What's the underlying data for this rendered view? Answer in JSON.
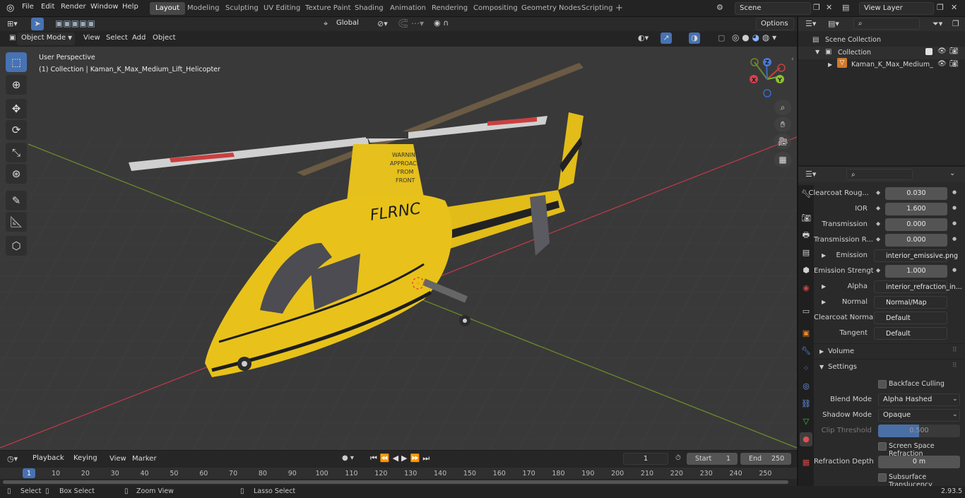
{
  "menu": [
    "File",
    "Edit",
    "Render",
    "Window",
    "Help"
  ],
  "workspaces": [
    "Layout",
    "Modeling",
    "Sculpting",
    "UV Editing",
    "Texture Paint",
    "Shading",
    "Animation",
    "Rendering",
    "Compositing",
    "Geometry Nodes",
    "Scripting"
  ],
  "scene": {
    "name": "Scene",
    "view_layer": "View Layer"
  },
  "header": {
    "mode": "Object Mode",
    "menus": [
      "View",
      "Select",
      "Add",
      "Object"
    ],
    "transform": "Global",
    "options": "Options"
  },
  "viewport": {
    "perspective": "User Perspective",
    "collection_info": "(1) Collection | Kaman_K_Max_Medium_Lift_Helicopter",
    "decal_text": "FLRNC",
    "warning_text": [
      "WARNING",
      "APPROACH",
      "FROM",
      "FRONT"
    ]
  },
  "gizmo": {
    "x": "X",
    "y": "Y",
    "z": "Z"
  },
  "outliner": {
    "root": "Scene Collection",
    "collection": "Collection",
    "object": "Kaman_K_Max_Medium_"
  },
  "properties": {
    "rows": [
      {
        "label": "Clearcoat Roug...",
        "value": "0.030"
      },
      {
        "label": "IOR",
        "value": "1.600"
      },
      {
        "label": "Transmission",
        "value": "0.000"
      },
      {
        "label": "Transmission R...",
        "value": "0.000"
      },
      {
        "label": "Emission",
        "value": "interior_emissive.png"
      },
      {
        "label": "Emission Strengt",
        "value": "1.000"
      },
      {
        "label": "Alpha",
        "value": "interior_refraction_in..."
      },
      {
        "label": "Normal",
        "value": "Normal/Map"
      },
      {
        "label": "Clearcoat Normal",
        "value": "Default"
      },
      {
        "label": "Tangent",
        "value": "Default"
      }
    ],
    "volume": "Volume",
    "settings": "Settings",
    "backface": "Backface Culling",
    "blend_mode_label": "Blend Mode",
    "blend_mode": "Alpha Hashed",
    "shadow_mode_label": "Shadow Mode",
    "shadow_mode": "Opaque",
    "clip_label": "Clip Threshold",
    "clip_value": "0.500",
    "ssr": "Screen Space Refraction",
    "refraction_label": "Refraction Depth",
    "refraction_value": "0 m",
    "sss": "Subsurface Translucency"
  },
  "timeline": {
    "menus": [
      "Playback",
      "Keying",
      "View",
      "Marker"
    ],
    "current_frame": "1",
    "start_label": "Start",
    "start": "1",
    "end_label": "End",
    "end": "250",
    "ticks": [
      "1",
      "10",
      "20",
      "30",
      "40",
      "50",
      "60",
      "70",
      "80",
      "90",
      "100",
      "110",
      "120",
      "130",
      "140",
      "150",
      "160",
      "170",
      "180",
      "190",
      "200",
      "210",
      "220",
      "230",
      "240",
      "250"
    ]
  },
  "status": {
    "select": "Select",
    "box_select": "Box Select",
    "zoom_view": "Zoom View",
    "lasso": "Lasso Select",
    "version": "2.93.5"
  },
  "colors": {
    "accent": "#4772b3",
    "heli_yellow": "#e8c21a",
    "axis_red": "#b83a48",
    "axis_green": "#6a8a2a"
  }
}
